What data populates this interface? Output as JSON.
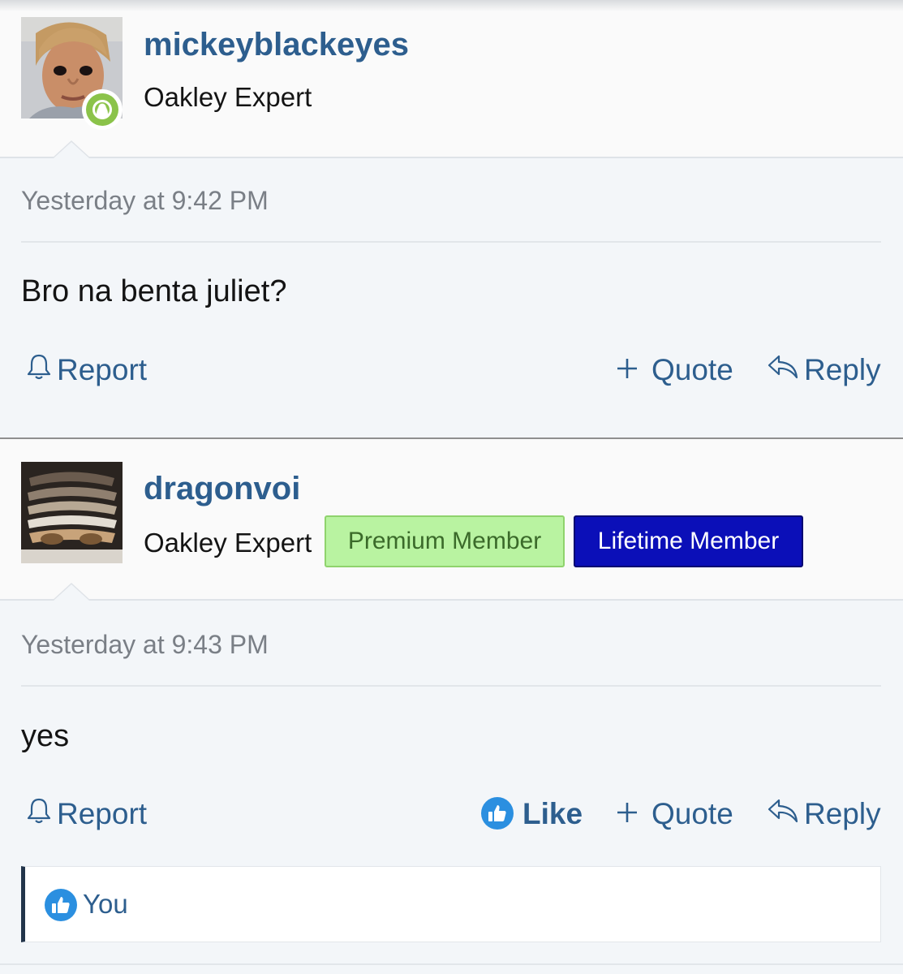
{
  "posts": [
    {
      "username": "mickeyblackeyes",
      "user_title": "Oakley Expert",
      "online": true,
      "date": "Yesterday at 9:42 PM",
      "message": "Bro na benta juliet?",
      "actions": {
        "report": "Report",
        "quote": "Quote",
        "reply": "Reply"
      }
    },
    {
      "username": "dragonvoi",
      "user_title": "Oakley Expert",
      "banners": [
        "Premium Member",
        "Lifetime Member"
      ],
      "date": "Yesterday at 9:43 PM",
      "message": "yes",
      "actions": {
        "report": "Report",
        "like": "Like",
        "quote": "Quote",
        "reply": "Reply"
      },
      "liked_by": "You"
    }
  ],
  "colors": {
    "link": "#2d5e8e",
    "online": "#8bc34a",
    "like": "#2b8fe0",
    "premium_banner": "#b9f3a1",
    "lifetime_banner": "#0b0fb8"
  },
  "icons": {
    "report": "bell-icon",
    "quote": "plus-icon",
    "reply": "reply-arrow-icon",
    "like": "thumbs-up-icon",
    "online": "user-online-icon"
  }
}
